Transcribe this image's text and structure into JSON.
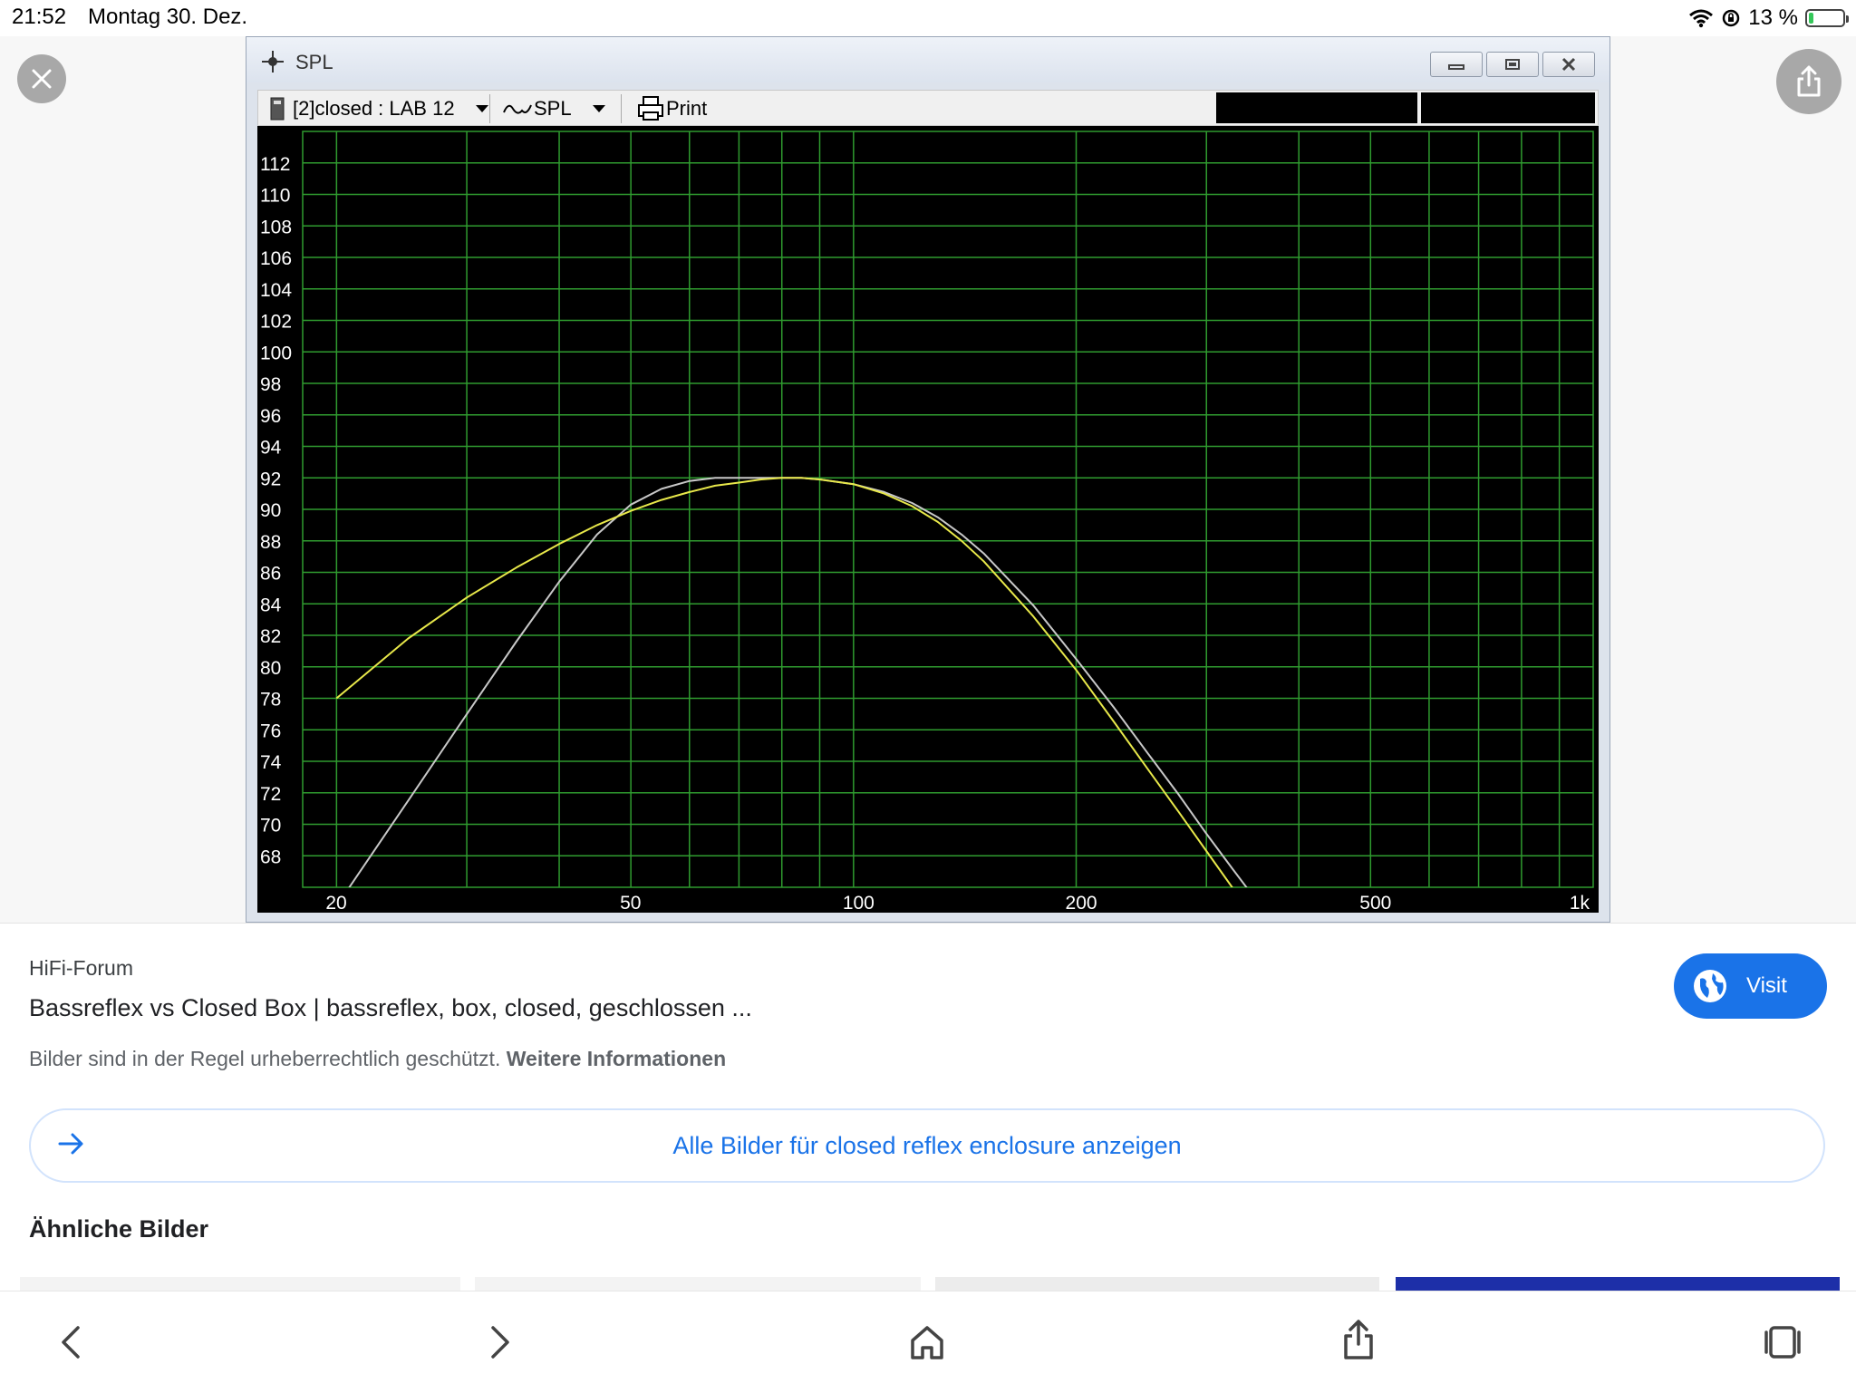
{
  "status": {
    "time": "21:52",
    "date": "Montag 30. Dez.",
    "battery": "13 %",
    "battery_level": 0.13
  },
  "window": {
    "title": "SPL",
    "toolbar": {
      "driver_select": "[2]closed : LAB 12",
      "view_select": "SPL",
      "print_label": "Print"
    }
  },
  "chart_data": {
    "type": "line",
    "x_scale": "log",
    "xlim": [
      18,
      1000
    ],
    "ylim": [
      66,
      114
    ],
    "x_ticks": [
      {
        "value": 20,
        "label": "20"
      },
      {
        "value": 50,
        "label": "50"
      },
      {
        "value": 100,
        "label": "100"
      },
      {
        "value": 200,
        "label": "200"
      },
      {
        "value": 500,
        "label": "500"
      },
      {
        "value": 1000,
        "label": "1k"
      }
    ],
    "y_ticks": [
      68,
      70,
      72,
      74,
      76,
      78,
      80,
      82,
      84,
      86,
      88,
      90,
      92,
      94,
      96,
      98,
      100,
      102,
      104,
      106,
      108,
      110,
      112
    ],
    "grid": true,
    "colors": {
      "background": "#000000",
      "grid": "#2f9b2f",
      "text": "#ffffff"
    },
    "series": [
      {
        "color": "#e8e84a",
        "x": [
          20,
          25,
          30,
          35,
          40,
          45,
          50,
          55,
          60,
          65,
          70,
          75,
          80,
          85,
          90,
          100,
          110,
          120,
          130,
          140,
          150,
          175,
          200,
          225,
          250,
          275,
          300,
          325,
          340
        ],
        "y": [
          78.0,
          81.8,
          84.4,
          86.3,
          87.8,
          89.0,
          89.9,
          90.6,
          91.1,
          91.5,
          91.7,
          91.9,
          92.0,
          92.0,
          91.9,
          91.6,
          91.0,
          90.2,
          89.2,
          88.0,
          86.7,
          83.2,
          79.8,
          76.5,
          73.5,
          70.8,
          68.3,
          66.0,
          64.8
        ]
      },
      {
        "color": "#c8c8c8",
        "x": [
          20,
          25,
          30,
          35,
          40,
          45,
          50,
          55,
          60,
          65,
          70,
          75,
          80,
          85,
          90,
          100,
          110,
          120,
          130,
          140,
          150,
          175,
          200,
          225,
          250,
          275,
          300,
          325,
          350,
          370
        ],
        "y": [
          64.8,
          71.5,
          77.0,
          81.6,
          85.4,
          88.4,
          90.3,
          91.3,
          91.8,
          92.0,
          92.0,
          92.0,
          92.0,
          92.0,
          91.9,
          91.6,
          91.1,
          90.4,
          89.5,
          88.4,
          87.2,
          83.9,
          80.5,
          77.4,
          74.5,
          71.9,
          69.4,
          67.2,
          65.2,
          64.8
        ]
      }
    ]
  },
  "result": {
    "source": "HiFi-Forum",
    "title": "Bassreflex vs Closed Box | bassreflex, box, closed, geschlossen ...",
    "copyright_text": "Bilder sind in der Regel urheberrechtlich geschützt.",
    "copyright_link": "Weitere Informationen",
    "visit_label": "Visit",
    "all_images_label": "Alle Bilder für closed reflex enclosure anzeigen",
    "similar_heading": "Ähnliche Bilder"
  },
  "icons": {
    "close": "close-icon",
    "share": "share-icon",
    "back": "back-icon",
    "forward": "forward-icon",
    "home": "home-icon",
    "tabs": "tabs-icon",
    "globe": "globe-icon",
    "arrow": "arrow-right-icon"
  }
}
